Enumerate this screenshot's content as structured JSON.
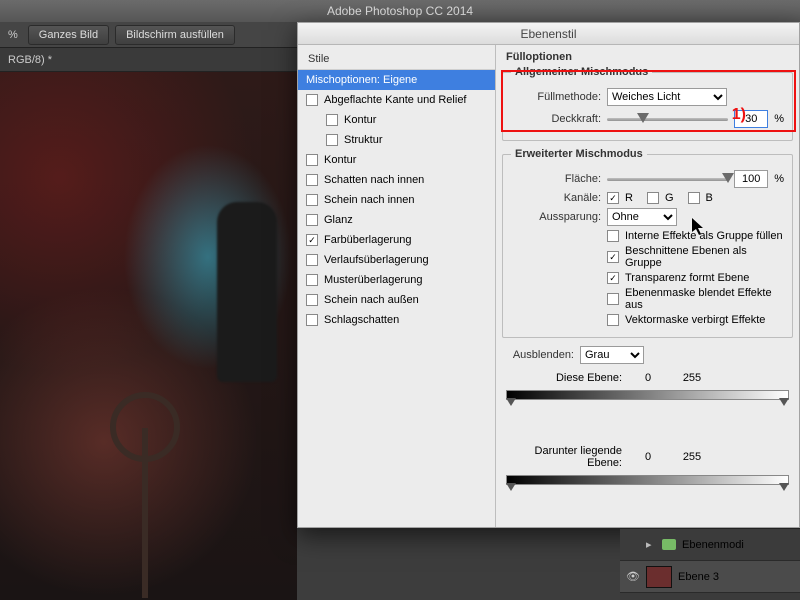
{
  "app_title": "Adobe Photoshop CC 2014",
  "optionbar": {
    "zoom_pct": "%",
    "btn_fit": "Ganzes Bild",
    "btn_fill": "Bildschirm ausfüllen"
  },
  "doc_tab": "RGB/8) *",
  "dlg": {
    "title": "Ebenenstil",
    "styles_header": "Stile",
    "style_items": [
      {
        "label": "Mischoptionen: Eigene",
        "selected": true,
        "checkbox": false,
        "checked": false,
        "indent": 0
      },
      {
        "label": "Abgeflachte Kante und Relief",
        "selected": false,
        "checkbox": true,
        "checked": false,
        "indent": 0
      },
      {
        "label": "Kontur",
        "selected": false,
        "checkbox": true,
        "checked": false,
        "indent": 1
      },
      {
        "label": "Struktur",
        "selected": false,
        "checkbox": true,
        "checked": false,
        "indent": 1
      },
      {
        "label": "Kontur",
        "selected": false,
        "checkbox": true,
        "checked": false,
        "indent": 0
      },
      {
        "label": "Schatten nach innen",
        "selected": false,
        "checkbox": true,
        "checked": false,
        "indent": 0
      },
      {
        "label": "Schein nach innen",
        "selected": false,
        "checkbox": true,
        "checked": false,
        "indent": 0
      },
      {
        "label": "Glanz",
        "selected": false,
        "checkbox": true,
        "checked": false,
        "indent": 0
      },
      {
        "label": "Farbüberlagerung",
        "selected": false,
        "checkbox": true,
        "checked": true,
        "indent": 0
      },
      {
        "label": "Verlaufsüberlagerung",
        "selected": false,
        "checkbox": true,
        "checked": false,
        "indent": 0
      },
      {
        "label": "Musterüberlagerung",
        "selected": false,
        "checkbox": true,
        "checked": false,
        "indent": 0
      },
      {
        "label": "Schein nach außen",
        "selected": false,
        "checkbox": true,
        "checked": false,
        "indent": 0
      },
      {
        "label": "Schlagschatten",
        "selected": false,
        "checkbox": true,
        "checked": false,
        "indent": 0
      }
    ],
    "fuell_head": "Fülloptionen",
    "general_head": "Allgemeiner Mischmodus",
    "fillmethod_label": "Füllmethode:",
    "fillmethod_value": "Weiches Licht",
    "opacity_label": "Deckkraft:",
    "opacity_value": "30",
    "pct": "%",
    "adv_head": "Erweiterter Mischmodus",
    "area_label": "Fläche:",
    "area_value": "100",
    "channels_label": "Kanäle:",
    "ch_r": "R",
    "ch_g": "G",
    "ch_b": "B",
    "knockout_label": "Aussparung:",
    "knockout_value": "Ohne",
    "adv_checks": [
      {
        "label": "Interne Effekte als Gruppe füllen",
        "checked": false
      },
      {
        "label": "Beschnittene Ebenen als Gruppe",
        "checked": true
      },
      {
        "label": "Transparenz formt Ebene",
        "checked": true
      },
      {
        "label": "Ebenenmaske blendet Effekte aus",
        "checked": false
      },
      {
        "label": "Vektormaske verbirgt Effekte",
        "checked": false
      }
    ],
    "blendif_label": "Ausblenden:",
    "blendif_value": "Grau",
    "range_this": "Diese Ebene:",
    "range_under": "Darunter liegende Ebene:",
    "range_lo": "0",
    "range_hi": "255",
    "annotation": "1)"
  },
  "layers": {
    "group_name": "Ebenenmodi",
    "layer_name": "Ebene 3"
  }
}
